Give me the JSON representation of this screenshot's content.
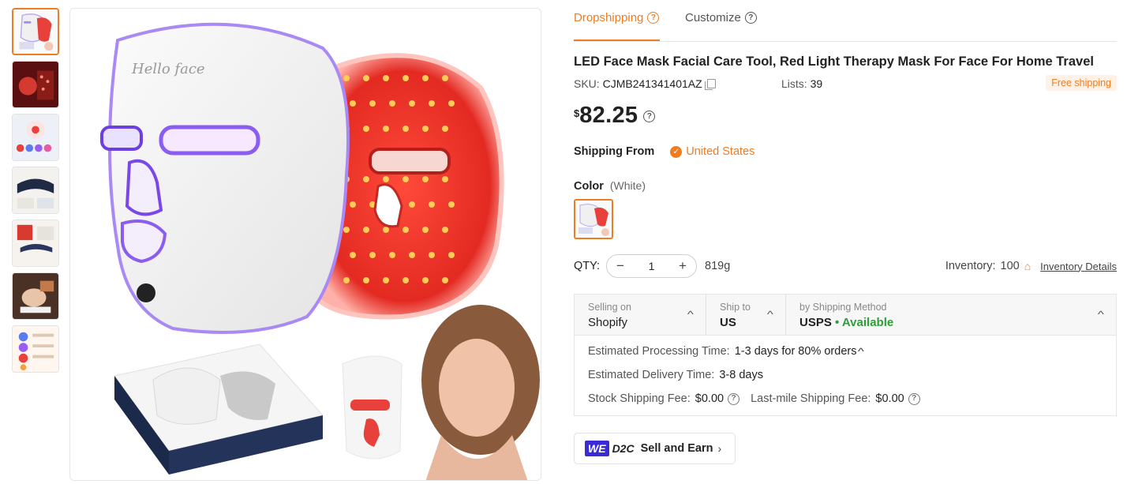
{
  "tabs": [
    {
      "label": "Dropshipping",
      "active": true
    },
    {
      "label": "Customize",
      "active": false
    }
  ],
  "product": {
    "title": "LED Face Mask Facial Care Tool, Red Light Therapy Mask For Face For Home Travel",
    "sku_label": "SKU:",
    "sku": "CJMB241341401AZ",
    "lists_label": "Lists:",
    "lists": "39",
    "free_shipping": "Free shipping",
    "currency": "$",
    "price": "82.25",
    "brand_text": "Hello face"
  },
  "shipping_from": {
    "label": "Shipping From",
    "country": "United States"
  },
  "color": {
    "label": "Color",
    "selected": "(White)"
  },
  "quantity": {
    "label": "QTY:",
    "minus": "−",
    "value": "1",
    "plus": "+",
    "weight": "819g",
    "inventory_label": "Inventory:",
    "inventory": "100",
    "inventory_details": "Inventory Details"
  },
  "shipping": {
    "selling_on_label": "Selling on",
    "selling_on": "Shopify",
    "ship_to_label": "Ship to",
    "ship_to": "US",
    "method_label": "by Shipping Method",
    "method": "USPS",
    "available": "• Available",
    "processing_label": "Estimated Processing Time:",
    "processing": "1-3 days for 80% orders",
    "delivery_label": "Estimated Delivery Time:",
    "delivery": "3-8 days",
    "stock_fee_label": "Stock Shipping Fee:",
    "stock_fee": "$0.00",
    "lastmile_fee_label": "Last-mile Shipping Fee:",
    "lastmile_fee": "$0.00"
  },
  "d2c": {
    "we": "WE",
    "tag": "D2C",
    "label": "Sell and Earn",
    "arrow": "›"
  },
  "colors": {
    "accent": "#f07c22",
    "available": "#2e9d3a",
    "mask_red": "#e8403a",
    "mask_purple": "#8a5cf0"
  }
}
